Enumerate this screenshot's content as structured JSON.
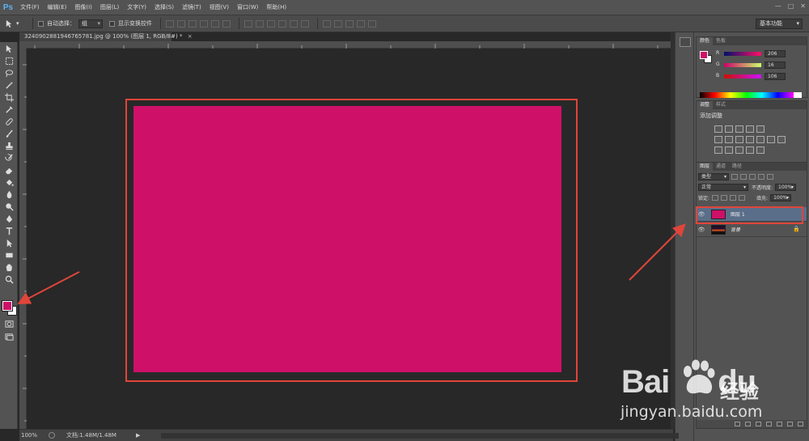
{
  "app": {
    "logo": "Ps"
  },
  "menu": [
    "文件(F)",
    "编辑(E)",
    "图像(I)",
    "图层(L)",
    "文字(Y)",
    "选择(S)",
    "滤镜(T)",
    "视图(V)",
    "窗口(W)",
    "帮助(H)"
  ],
  "window_controls": [
    "—",
    "□",
    "✕"
  ],
  "options_bar": {
    "auto_select_label": "自动选择：",
    "auto_select_value": "组",
    "show_transform_label": "显示变换控件",
    "workspace": "基本功能"
  },
  "document": {
    "tab_title": "32409028819467657​81.jpg @ 100% (图层 1, RGB/8#) *",
    "tab_close": "×",
    "canvas_color": "#ce1068"
  },
  "status": {
    "zoom": "100%",
    "doc_info": "文档:1.48M/1.48M"
  },
  "color_panel": {
    "tabs": [
      "颜色",
      "色板"
    ],
    "fg_color": "#ce1068",
    "bg_color": "#ffffff",
    "r": {
      "label": "R",
      "value": "206"
    },
    "g": {
      "label": "G",
      "value": "16"
    },
    "b": {
      "label": "B",
      "value": "106"
    }
  },
  "adjustments_panel": {
    "tabs": [
      "调整",
      "样式"
    ],
    "title": "添加调整"
  },
  "layers_panel": {
    "tabs": [
      "图层",
      "通道",
      "路径"
    ],
    "filter": "类型",
    "blend_mode": "正常",
    "opacity_label": "不透明度:",
    "opacity_value": "100%",
    "lock_label": "锁定:",
    "fill_label": "填充:",
    "fill_value": "100%",
    "layers": [
      {
        "name": "图层 1",
        "selected": true
      },
      {
        "name": "背景",
        "selected": false,
        "locked": true
      }
    ]
  },
  "watermark": {
    "brand_a": "Bai",
    "brand_b": "du",
    "brand_cn": "经验",
    "url": "jingyan.baidu.com"
  }
}
